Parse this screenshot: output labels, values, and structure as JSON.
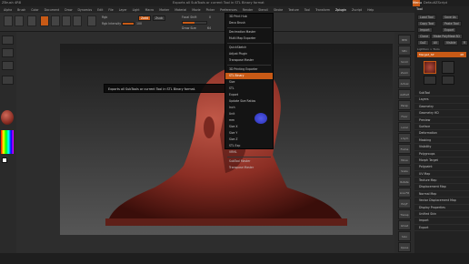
{
  "topbar": {
    "app_title": "ZBrush 4R8",
    "center_text": "Exports all SubTools or current Tool in STL Binary format",
    "menu_label": "Menu",
    "default_label": "DefaultZScript"
  },
  "menubar": {
    "items": [
      "Alpha",
      "Brush",
      "Color",
      "Document",
      "Draw",
      "Dynamics",
      "Edit",
      "File",
      "Layer",
      "Light",
      "Macro",
      "Marker",
      "Material",
      "Movie",
      "Picker",
      "Preferences",
      "Render",
      "Stencil",
      "Stroke",
      "Texture",
      "Tool",
      "Transform",
      "Zplugin",
      "Zscript",
      "Help"
    ],
    "selected": "Zplugin"
  },
  "toolbar": {
    "rgb_label": "Rgb",
    "intensity_label": "Rgb Intensity",
    "intensity_value": "100",
    "zadd": "Zadd",
    "zsub": "Zsub",
    "focal_label": "Focal Shift",
    "focal_value": "0",
    "draw_size_label": "Draw Size",
    "draw_size_value": "64",
    "dynamic_label": "Dynamic"
  },
  "popup": {
    "items": [
      "3D Print Hub",
      "Deco Brush",
      "Decimation Master",
      "Multi Map Exporter",
      "QuickSketch",
      "Adjust Plugin",
      "Transpose Master",
      "3D Printing Exporter",
      "STL Binary",
      "Size",
      "STL",
      "Export",
      "Update Size Ratios",
      "Inch",
      "Unit",
      "mm",
      "Size X",
      "Size Y",
      "Size Z",
      "STL Exp",
      "VRML",
      "SubTool Master",
      "Transpose Master"
    ],
    "highlighted": "STL Binary",
    "header": "3D Printing Exporter"
  },
  "tooltip": {
    "text": "Exports all SubTools or current Tool in STL Binary format."
  },
  "rightpanel": {
    "title": "Tool",
    "buttons": [
      "Load Tool",
      "Save As",
      "Copy Tool",
      "Paste Tool",
      "Import",
      "Export",
      "Clone",
      "Make PolyMesh3D",
      "GoZ",
      "All",
      "Visible",
      "R"
    ],
    "lightbox_label": "Lightbox > Tools",
    "tool_name": "Merged_SP",
    "tool_value": "48",
    "sections": [
      "SubTool",
      "Layers",
      "Geometry",
      "Geometry HD",
      "Preview",
      "Surface",
      "Deformation",
      "Masking",
      "Visibility",
      "Polygroups",
      "Morph Target",
      "Polypaint",
      "UV Map",
      "Texture Map",
      "Displacement Map",
      "Normal Map",
      "Vector Displacement Map",
      "Display Properties",
      "Unified Skin",
      "Import",
      "Export"
    ]
  },
  "rightshelf": {
    "buttons": [
      "BPR",
      "SPix",
      "Scroll",
      "Zoom",
      "Actual",
      "AAHalf",
      "Persp",
      "Floor",
      "Local",
      "L.Sym",
      "Frame",
      "Move",
      "Scale",
      "Rotate",
      "Line Fill",
      "PolyF",
      "Transp",
      "Ghost",
      "Solo",
      "Xpose"
    ]
  },
  "colors": {
    "accent": "#c85a16",
    "background": "#2d2d2d",
    "panel": "#222222",
    "model": "#8b2e24"
  }
}
